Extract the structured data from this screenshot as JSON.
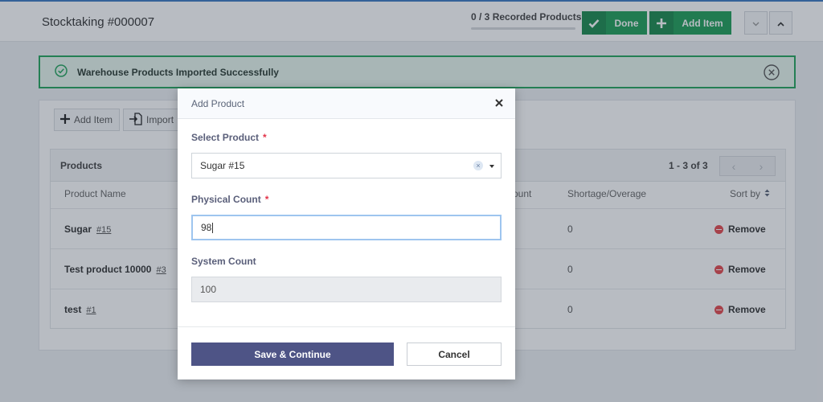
{
  "header": {
    "title": "Stocktaking #000007",
    "progress_count": "0 / 3",
    "progress_label": "Recorded Products",
    "done_label": "Done",
    "add_item_label": "Add Item"
  },
  "alert": {
    "message": "Warehouse Products Imported Successfully"
  },
  "toolbar": {
    "add_item_label": "Add Item",
    "import_label": "Import"
  },
  "products": {
    "title": "Products",
    "pager_text": "1 - 3 of 3",
    "columns": {
      "name": "Product Name",
      "count_partial": "ount",
      "shortage": "Shortage/Overage",
      "sort": "Sort by"
    },
    "rows": [
      {
        "name": "Sugar",
        "id": "#15",
        "shortage": "0",
        "action": "Remove"
      },
      {
        "name": "Test product 10000",
        "id": "#3",
        "shortage": "0",
        "action": "Remove"
      },
      {
        "name": "test",
        "id": "#1",
        "shortage": "0",
        "action": "Remove"
      }
    ]
  },
  "modal": {
    "title": "Add Product",
    "select_product_label": "Select Product",
    "selected_product": "Sugar #15",
    "physical_count_label": "Physical Count",
    "physical_count_value": "98",
    "system_count_label": "System Count",
    "system_count_value": "100",
    "required_mark": "*",
    "save_label": "Save & Continue",
    "cancel_label": "Cancel"
  },
  "colors": {
    "primary_green": "#1e9e57",
    "modal_primary": "#4e5486",
    "remove_red": "#e5484d",
    "alert_border": "#23a55c"
  }
}
